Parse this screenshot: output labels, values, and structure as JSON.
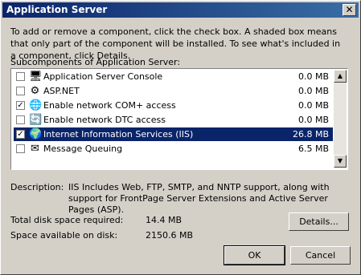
{
  "window": {
    "title": "Application Server",
    "close_glyph": "✕"
  },
  "intro_text": "To add or remove a component, click the check box. A shaded box means that only part of the component will be installed. To see what's included in a component, click Details.",
  "section_label": "Subcomponents of Application Server:",
  "components": [
    {
      "label": "Application Server Console",
      "size": "0.0 MB",
      "checked": false,
      "icon": "console-icon",
      "glyph": "🖥",
      "selected": false
    },
    {
      "label": "ASP.NET",
      "size": "0.0 MB",
      "checked": false,
      "icon": "gear-icon",
      "glyph": "⚙",
      "selected": false
    },
    {
      "label": "Enable network COM+ access",
      "size": "0.0 MB",
      "checked": true,
      "icon": "network-icon",
      "glyph": "🌐",
      "selected": false
    },
    {
      "label": "Enable network DTC access",
      "size": "0.0 MB",
      "checked": false,
      "icon": "network-dtc-icon",
      "glyph": "🔄",
      "selected": false
    },
    {
      "label": "Internet Information Services (IIS)",
      "size": "26.8 MB",
      "checked": true,
      "icon": "iis-icon",
      "glyph": "🌍",
      "selected": true
    },
    {
      "label": "Message Queuing",
      "size": "6.5 MB",
      "checked": false,
      "icon": "envelope-icon",
      "glyph": "✉",
      "selected": false
    }
  ],
  "scroll": {
    "up_glyph": "▲",
    "down_glyph": "▼"
  },
  "description": {
    "label": "Description:",
    "text": "IIS Includes Web, FTP, SMTP, and NNTP support, along with support for FrontPage Server Extensions and Active Server Pages (ASP)."
  },
  "disk": {
    "required_label": "Total disk space required:",
    "required_value": "14.4 MB",
    "available_label": "Space available on disk:",
    "available_value": "2150.6 MB"
  },
  "buttons": {
    "details": "Details...",
    "ok": "OK",
    "cancel": "Cancel"
  }
}
